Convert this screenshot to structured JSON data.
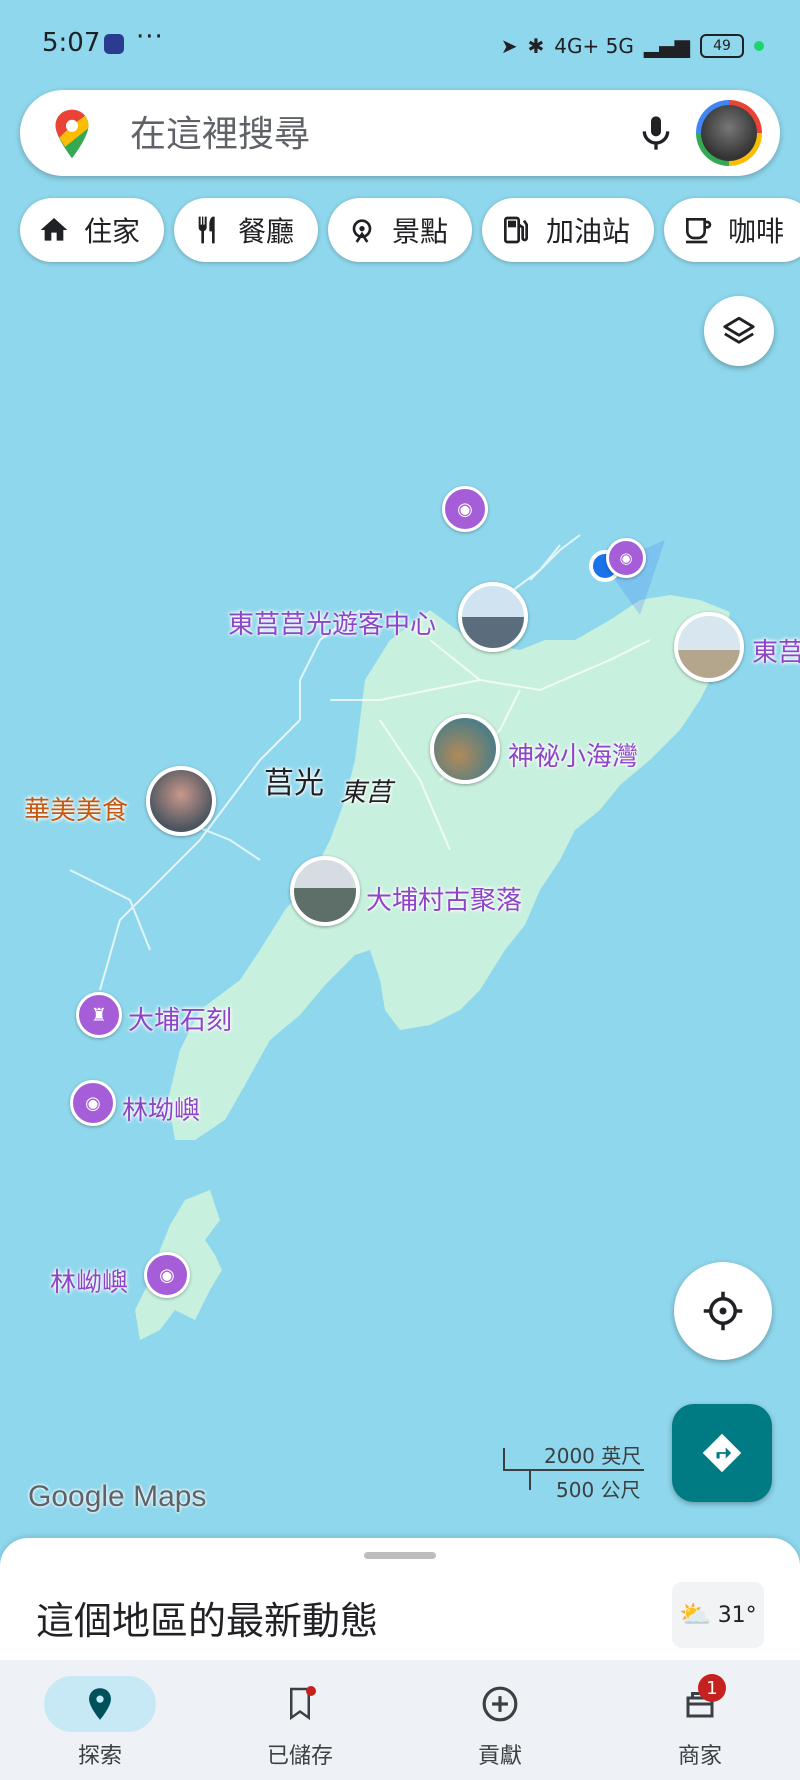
{
  "status_bar": {
    "time": "5:07",
    "more": "···",
    "network": "4G+  5G",
    "battery": "49"
  },
  "search": {
    "placeholder": "在這裡搜尋"
  },
  "chips": [
    {
      "label": "住家",
      "icon": "home-icon"
    },
    {
      "label": "餐廳",
      "icon": "restaurant-icon"
    },
    {
      "label": "景點",
      "icon": "attraction-icon"
    },
    {
      "label": "加油站",
      "icon": "gas-station-icon"
    },
    {
      "label": "咖啡",
      "icon": "coffee-icon"
    }
  ],
  "map": {
    "places": {
      "visitor_center": "東莒莒光遊客中心",
      "east_cut": "東莒",
      "secret_bay": "神祕小海灣",
      "restaurant": "華美美食",
      "town_jg": "莒光",
      "town_dj": "東莒",
      "dapu_village": "大埔村古聚落",
      "dapu_carving": "大埔石刻",
      "linao_islet": "林坳嶼",
      "linao_islet2": "林岰嶼"
    },
    "logo": "Google Maps",
    "scale": {
      "imperial": "2000 英尺",
      "metric": "500 公尺"
    }
  },
  "sheet": {
    "title": "這個地區的最新動態",
    "temperature": "31°"
  },
  "nav": [
    {
      "label": "探索",
      "icon": "explore-pin-icon",
      "active": true
    },
    {
      "label": "已儲存",
      "icon": "bookmark-icon"
    },
    {
      "label": "貢獻",
      "icon": "add-circle-icon"
    },
    {
      "label": "商家",
      "icon": "business-icon",
      "badge": "1"
    }
  ]
}
